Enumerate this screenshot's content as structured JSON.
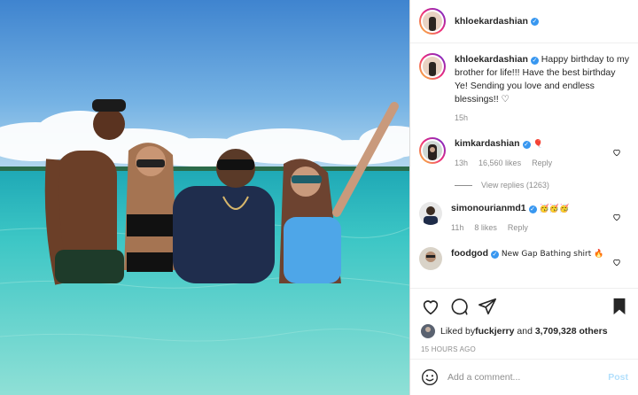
{
  "post": {
    "author": "khloekardashian",
    "caption": "Happy birthday to my brother for life!!! Have the best birthday Ye! Sending you love and endless blessings!! ♡",
    "caption_age": "15h"
  },
  "comments": [
    {
      "user": "kimkardashian",
      "text": "🎈",
      "age": "13h",
      "likes": "16,560 likes",
      "reply": "Reply",
      "view_replies": "View replies (1263)"
    },
    {
      "user": "simonourianmd1",
      "text": "🥳🥳🥳",
      "age": "11h",
      "likes": "8 likes",
      "reply": "Reply"
    },
    {
      "user": "foodgod",
      "text": "New Gap Bathing shirt 🔥"
    }
  ],
  "engagement": {
    "liked_by_prefix": "Liked by ",
    "liked_by_user": "fuckjerry",
    "liked_by_mid": " and ",
    "liked_by_count": "3,709,328 others",
    "timestamp": "15 HOURS AGO"
  },
  "add_comment": {
    "placeholder": "Add a comment...",
    "post_label": "Post"
  },
  "icons": [
    "heart-icon",
    "comment-icon",
    "share-icon",
    "bookmark-icon",
    "smiley-icon",
    "verified-badge"
  ],
  "colors": {
    "link_blue": "#3897f0",
    "post_disabled": "#b2dffc",
    "meta_gray": "#8e8e8e",
    "sea": "#37c3c6",
    "sky": "#4d93d6"
  }
}
